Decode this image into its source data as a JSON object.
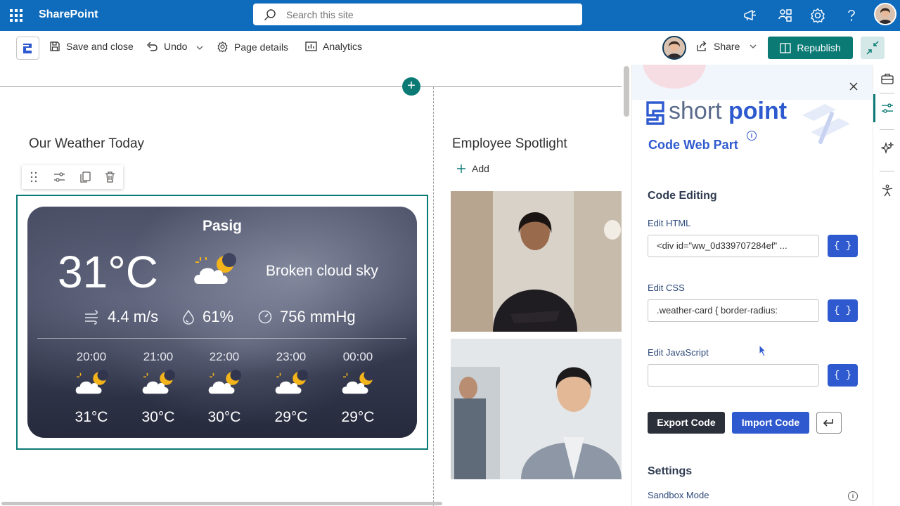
{
  "suite": {
    "app_name": "SharePoint",
    "search_placeholder": "Search this site"
  },
  "commandbar": {
    "save_close": "Save and close",
    "undo": "Undo",
    "page_details": "Page details",
    "analytics": "Analytics",
    "share": "Share",
    "republish": "Republish"
  },
  "canvas": {
    "weather_section_title": "Our Weather Today",
    "employee_section_title": "Employee Spotlight",
    "add_label": "Add"
  },
  "weather": {
    "city": "Pasig",
    "temperature": "31°C",
    "condition": "Broken cloud sky",
    "wind": "4.4 m/s",
    "humidity": "61%",
    "pressure": "756 mmHg",
    "hourly": [
      {
        "time": "20:00",
        "temp": "31°C"
      },
      {
        "time": "21:00",
        "temp": "30°C"
      },
      {
        "time": "22:00",
        "temp": "30°C"
      },
      {
        "time": "23:00",
        "temp": "29°C"
      },
      {
        "time": "00:00",
        "temp": "29°C"
      }
    ]
  },
  "pane": {
    "brand_light": "short",
    "brand_bold": "point",
    "title": "Code Web Part",
    "code_editing": "Code Editing",
    "edit_html_label": "Edit HTML",
    "edit_html_value": "<div id=\"ww_0d339707284ef\" ...",
    "edit_css_label": "Edit CSS",
    "edit_css_value": ".weather-card {    border-radius:",
    "edit_js_label": "Edit JavaScript",
    "edit_js_value": "",
    "brace": "{ }",
    "export_code": "Export Code",
    "import_code": "Import Code",
    "settings": "Settings",
    "sandbox_mode": "Sandbox Mode"
  },
  "colors": {
    "suite_blue": "#0f6cbd",
    "teal": "#0b7a75",
    "shortpoint_blue": "#2f5acf"
  }
}
